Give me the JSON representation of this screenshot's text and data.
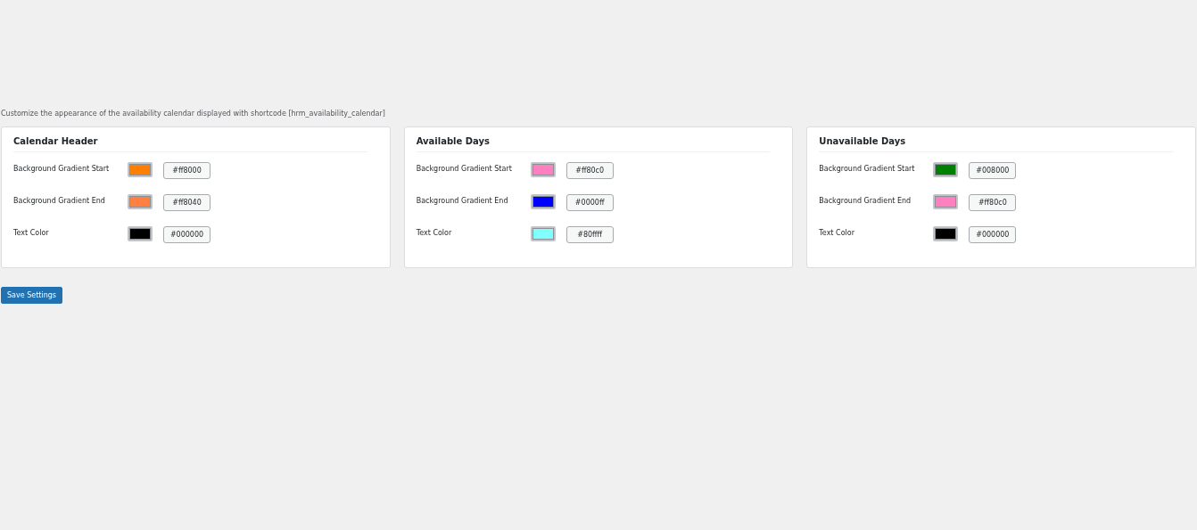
{
  "description": "Customize the appearance of the availability calendar displayed with shortcode [hrm_availability_calendar]",
  "sections": [
    {
      "title": "Calendar Header",
      "fields": [
        {
          "label": "Background Gradient Start",
          "color": "#ff8000",
          "value": "#ff8000"
        },
        {
          "label": "Background Gradient End",
          "color": "#ff8040",
          "value": "#ff8040"
        },
        {
          "label": "Text Color",
          "color": "#000000",
          "value": "#000000"
        }
      ]
    },
    {
      "title": "Available Days",
      "fields": [
        {
          "label": "Background Gradient Start",
          "color": "#ff80c0",
          "value": "#ff80c0"
        },
        {
          "label": "Background Gradient End",
          "color": "#0000ff",
          "value": "#0000ff"
        },
        {
          "label": "Text Color",
          "color": "#80ffff",
          "value": "#80ffff"
        }
      ]
    },
    {
      "title": "Unavailable Days",
      "fields": [
        {
          "label": "Background Gradient Start",
          "color": "#008000",
          "value": "#008000"
        },
        {
          "label": "Background Gradient End",
          "color": "#ff80c0",
          "value": "#ff80c0"
        },
        {
          "label": "Text Color",
          "color": "#000000",
          "value": "#000000"
        }
      ]
    }
  ],
  "save_button": "Save Settings"
}
